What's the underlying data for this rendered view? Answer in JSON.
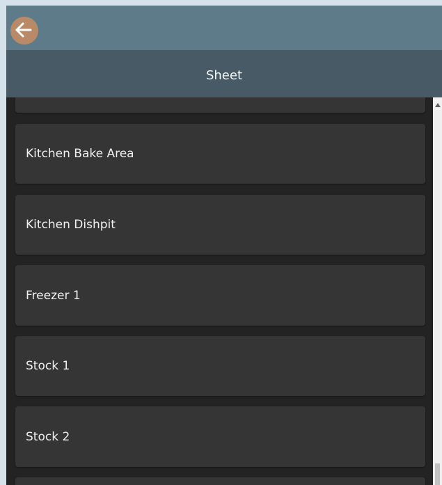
{
  "header": {
    "title": "Sheet"
  },
  "list": {
    "items": [
      {
        "label": ""
      },
      {
        "label": "Kitchen Bake Area"
      },
      {
        "label": "Kitchen Dishpit"
      },
      {
        "label": "Freezer 1"
      },
      {
        "label": "Stock 1"
      },
      {
        "label": "Stock 2"
      },
      {
        "label": ""
      }
    ]
  },
  "colors": {
    "titlebar": "#5e7b89",
    "header": "#475a65",
    "list_background": "#232323",
    "item_background": "#353535",
    "back_button": "#b98a68"
  },
  "icons": {
    "back": "arrow-left-icon"
  }
}
